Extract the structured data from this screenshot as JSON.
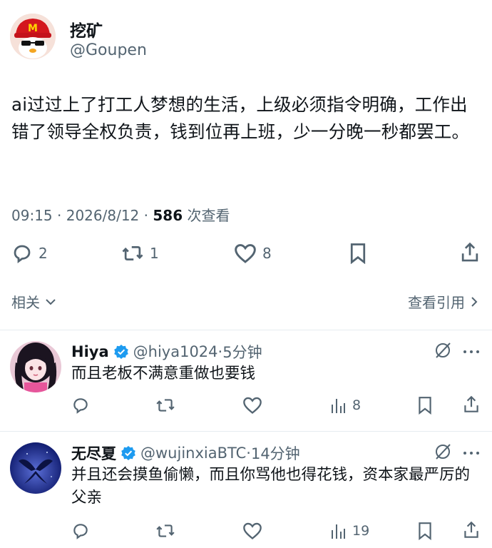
{
  "tweet": {
    "author_name": "挖矿",
    "author_handle": "@Goupen",
    "text": "ai过过上了打工人梦想的生活，上级必须指令明确，工作出错了领导全权负责，钱到位再上班，少一分晚一秒都罢工。",
    "time": "09:15",
    "date": "2026/8/12",
    "views": "586",
    "views_label": "次查看",
    "replies": "2",
    "retweets": "1",
    "likes": "8"
  },
  "related_label": "相关",
  "view_quotes_label": "查看引用",
  "replies": [
    {
      "name": "Hiya",
      "handle": "@hiya1024",
      "time": "5分钟",
      "text": "而且老板不满意重做也要钱",
      "views": "8",
      "verified": true
    },
    {
      "name": "无尽夏",
      "handle": "@wujinxiaBTC",
      "time": "14分钟",
      "text": "并且还会摸鱼偷懒，而且你骂他也得花钱，资本家最严厉的父亲",
      "views": "19",
      "verified": true
    }
  ],
  "colors": {
    "text": "#0f1419",
    "muted": "#536471",
    "verified": "#1d9bf0",
    "divider": "#e6ecf0"
  }
}
